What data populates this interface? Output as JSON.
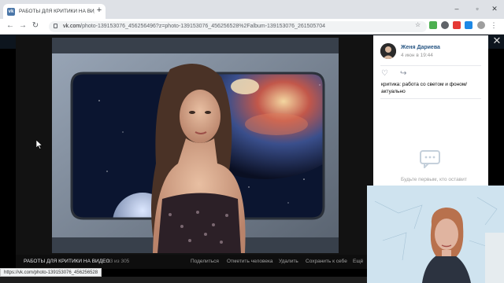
{
  "browser": {
    "tab_title": "РАБОТЫ ДЛЯ КРИТИКИ НА ВИДЕ",
    "tab_favicon": "vk-icon",
    "tab_close": "×",
    "newtab": "+",
    "win_min": "–",
    "win_max": "▫",
    "win_close": "✕",
    "url_host": "vk.com",
    "url_path": "/photo-139153076_456256496?z=photo-139153076_456256528%2Falbum-139153076_261505704",
    "status_url": "https://vk.com/photo-139153076_456256528"
  },
  "viewer": {
    "album_title": "РАБОТЫ ДЛЯ КРИТИКИ НА ВИДЕО",
    "count": "13 из 305",
    "actions": [
      "Поделиться",
      "Отметить человека",
      "Удалить",
      "Сохранить к себе",
      "Ещё"
    ]
  },
  "panel": {
    "author": "Женя Дариева",
    "date": "4 июн в 19:44",
    "description": "критика: работа со светом и фоном/ актуально",
    "no_comments": "Будьте первым, кто оставит"
  },
  "colors": {
    "vk_blue": "#4a76a8",
    "link": "#2a5885"
  }
}
